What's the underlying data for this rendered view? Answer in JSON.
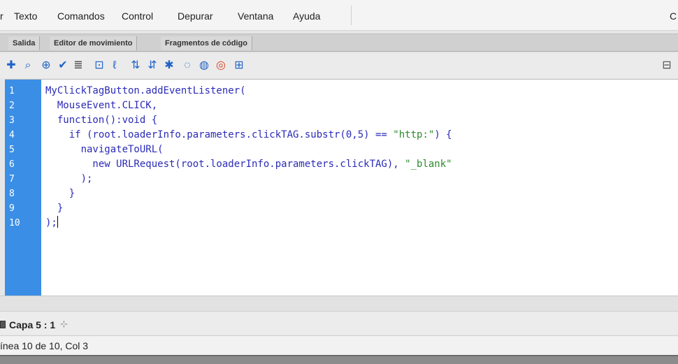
{
  "menu": {
    "items": [
      "r",
      "Texto",
      "Comandos",
      "Control",
      "Depurar",
      "Ventana",
      "Ayuda"
    ],
    "right_partial": "C"
  },
  "tabs": [
    "Salida",
    "Editor de movimiento",
    "Fragmentos de código"
  ],
  "toolbar": {
    "icons": [
      "add-item-icon",
      "find-icon",
      "target-icon",
      "check-syntax-icon",
      "auto-format-icon",
      "code-hint-icon",
      "debug-icon",
      "collapse-between-icon",
      "collapse-selection-icon",
      "expand-all-icon",
      "apply-block-comment-icon",
      "apply-line-comment-icon",
      "remove-comment-icon",
      "wrap-icon"
    ],
    "help_icon": "help-icon"
  },
  "editor": {
    "line_numbers": [
      "1",
      "2",
      "3",
      "4",
      "5",
      "6",
      "7",
      "8",
      "9",
      "10"
    ],
    "lines": [
      "MyClickTagButton.addEventListener(",
      "  MouseEvent.CLICK,",
      "  function():void {",
      "    if (root.loaderInfo.parameters.clickTAG.substr(0,5) == \"http:\") {",
      "      navigateToURL(",
      "        new URLRequest(root.loaderInfo.parameters.clickTAG), \"_blank\"",
      "      );",
      "    }",
      "  }",
      ");"
    ]
  },
  "layer": {
    "label": "Capa 5 : 1"
  },
  "status": {
    "text": "ínea 10 de 10, Col 3"
  },
  "colors": {
    "gutter": "#3a8ee6",
    "code_text": "#2b2bb8",
    "string": "#2b8a2b"
  }
}
